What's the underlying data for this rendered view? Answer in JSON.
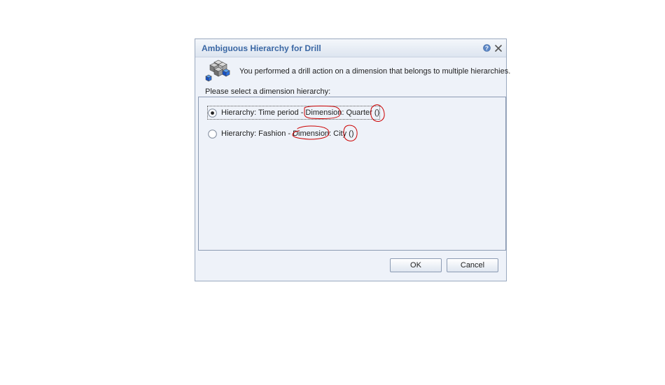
{
  "dialog": {
    "title": "Ambiguous Hierarchy for Drill",
    "help_icon": "help-icon",
    "close_icon": "close-icon",
    "message_icon": "dimension-cubes-icon",
    "message": "You performed a drill action on a dimension that belongs to multiple hierarchies.",
    "prompt": "Please select a dimension hierarchy:",
    "options": [
      {
        "label": "Hierarchy: Time period - Dimension: Quarter ()",
        "selected": true
      },
      {
        "label": "Hierarchy: Fashion - Dimension: City ()",
        "selected": false
      }
    ],
    "ok_label": "OK",
    "cancel_label": "Cancel"
  },
  "colors": {
    "title_text": "#3a67a4",
    "dialog_background": "#eef2f9",
    "annotation_ink": "#cc0000"
  }
}
